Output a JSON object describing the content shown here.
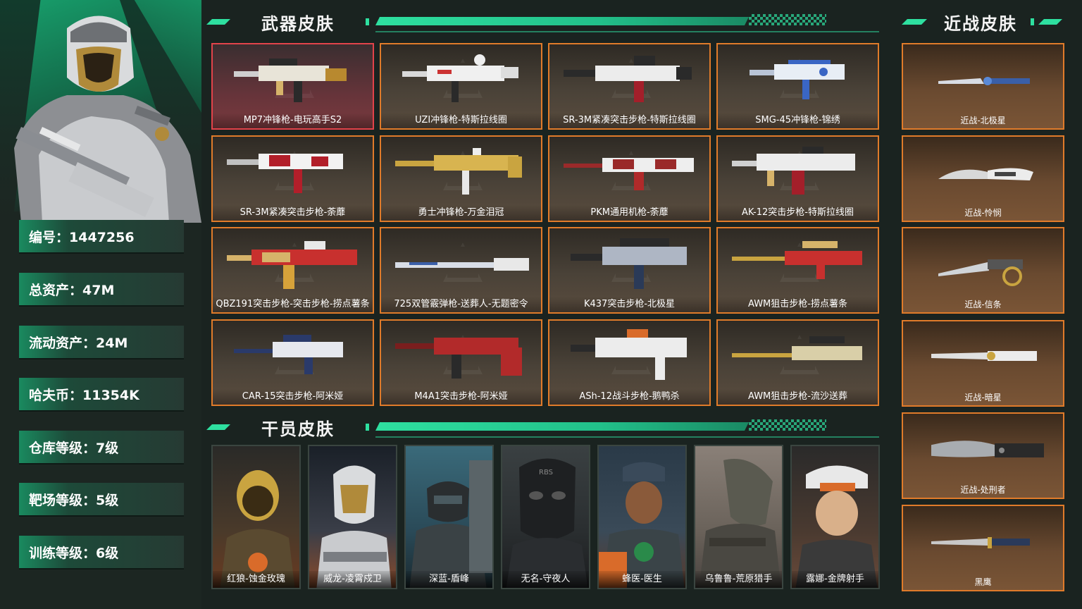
{
  "profile": {
    "stats": [
      {
        "label": "编号：1447256"
      },
      {
        "label": "总资产：47M"
      },
      {
        "label": "流动资产：24M"
      },
      {
        "label": "哈夫币：11354K"
      },
      {
        "label": "仓库等级：7级"
      },
      {
        "label": "靶场等级：5级"
      },
      {
        "label": "训练等级：6级"
      }
    ]
  },
  "sections": {
    "weapons_title": "武器皮肤",
    "operators_title": "干员皮肤",
    "melee_title": "近战皮肤"
  },
  "weapons": [
    {
      "label": "MP7冲锋枪-电玩高手S2",
      "featured": true
    },
    {
      "label": "UZI冲锋枪-特斯拉线圈"
    },
    {
      "label": "SR-3M紧凑突击步枪-特斯拉线圈"
    },
    {
      "label": "SMG-45冲锋枪-锦绣"
    },
    {
      "label": "SR-3M紧凑突击步枪-荼蘼"
    },
    {
      "label": "勇士冲锋枪-万金泪冠"
    },
    {
      "label": "PKM通用机枪-荼蘼"
    },
    {
      "label": "AK-12突击步枪-特斯拉线圈"
    },
    {
      "label": "QBZ191突击步枪-突击步枪-捞点薯条"
    },
    {
      "label": "725双管霰弹枪-送葬人-无题密令"
    },
    {
      "label": "K437突击步枪-北极星"
    },
    {
      "label": "AWM狙击步枪-捞点薯条"
    },
    {
      "label": "CAR-15突击步枪-阿米娅"
    },
    {
      "label": "M4A1突击步枪-阿米娅"
    },
    {
      "label": "ASh-12战斗步枪-鹅鸭杀"
    },
    {
      "label": "AWM狙击步枪-流沙送葬"
    }
  ],
  "operators": [
    {
      "label": "红狼-蚀金玫瑰"
    },
    {
      "label": "威龙-凌霄戍卫"
    },
    {
      "label": "深蓝-盾峰"
    },
    {
      "label": "无名-守夜人",
      "mask_text": "RBS"
    },
    {
      "label": "蜂医-医生"
    },
    {
      "label": "乌鲁鲁-荒原猎手"
    },
    {
      "label": "露娜-金牌射手"
    }
  ],
  "melee": [
    {
      "label": "近战-北极星"
    },
    {
      "label": "近战-怜悯"
    },
    {
      "label": "近战-信条"
    },
    {
      "label": "近战-暗星"
    },
    {
      "label": "近战-处刑者"
    },
    {
      "label": "黑鹰"
    }
  ],
  "colors": {
    "accent": "#2ee0a0",
    "card_border": "#e07b2a",
    "featured_border": "#e2434a"
  }
}
